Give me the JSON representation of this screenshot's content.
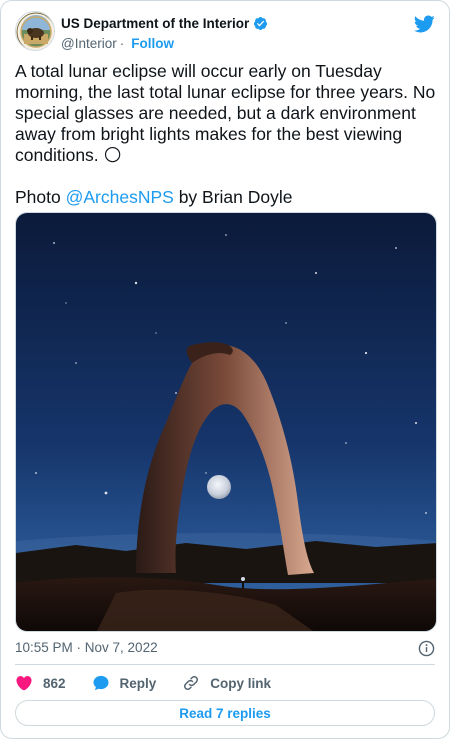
{
  "account": {
    "display_name": "US Department of the Interior",
    "handle": "@Interior",
    "separator": "·",
    "follow_label": "Follow"
  },
  "tweet": {
    "text_before_emoji": "A total lunar eclipse will occur early on Tuesday morning, the last total lunar eclipse for three years. No special glasses are needed, but a dark environment away from bright lights makes for the best viewing conditions. ",
    "emoji": "🌕",
    "photo_prefix": "Photo ",
    "photo_mention": "@ArchesNPS",
    "photo_suffix": " by Brian Doyle"
  },
  "meta": {
    "timestamp": "10:55 PM · Nov 7, 2022"
  },
  "actions": {
    "like_count": "862",
    "reply_label": "Reply",
    "copy_link_label": "Copy link"
  },
  "replies": {
    "label": "Read 7 replies"
  },
  "colors": {
    "accent": "#1d9bf0",
    "like": "#f91880",
    "text": "#0f1419",
    "muted": "#536471",
    "border": "#cfd9de"
  },
  "icons": [
    "doi-seal-avatar",
    "verified-badge-icon",
    "twitter-bird-icon",
    "info-icon",
    "heart-icon",
    "reply-bubble-icon",
    "link-icon",
    "full-moon-emoji"
  ]
}
